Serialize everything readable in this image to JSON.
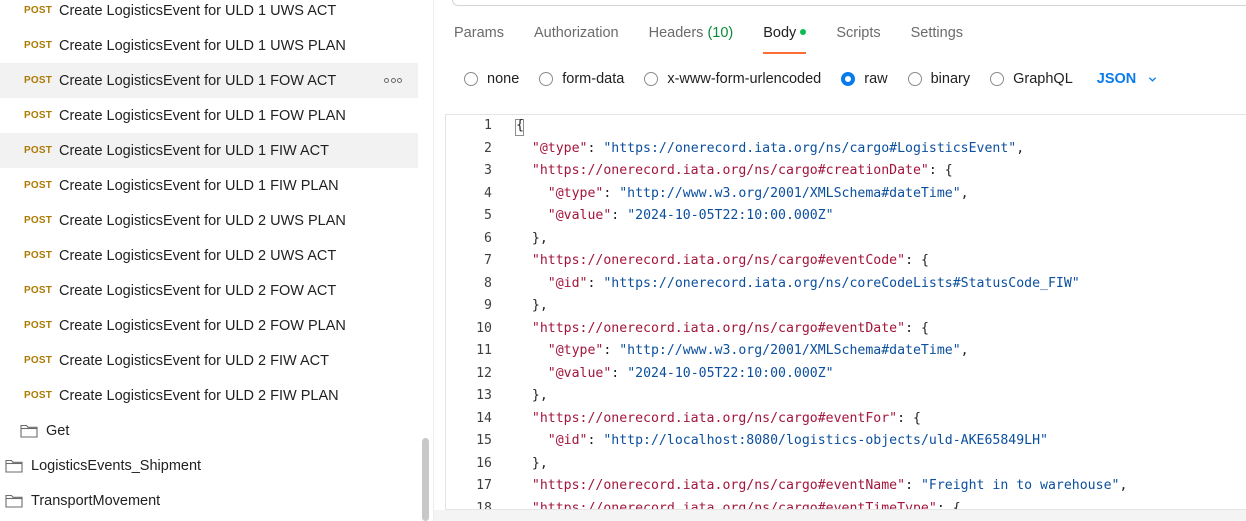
{
  "sidebar": {
    "items": [
      {
        "method": "POST",
        "name": "Create LogisticsEvent for ULD 1 UWS ACT"
      },
      {
        "method": "POST",
        "name": "Create LogisticsEvent for ULD 1 UWS PLAN"
      },
      {
        "method": "POST",
        "name": "Create LogisticsEvent for ULD 1 FOW ACT"
      },
      {
        "method": "POST",
        "name": "Create LogisticsEvent for ULD 1 FOW PLAN"
      },
      {
        "method": "POST",
        "name": "Create LogisticsEvent for ULD 1 FIW ACT"
      },
      {
        "method": "POST",
        "name": "Create LogisticsEvent for ULD 1 FIW PLAN"
      },
      {
        "method": "POST",
        "name": "Create LogisticsEvent for ULD 2 UWS PLAN"
      },
      {
        "method": "POST",
        "name": "Create LogisticsEvent for ULD 2 UWS ACT"
      },
      {
        "method": "POST",
        "name": "Create LogisticsEvent for ULD 2 FOW ACT"
      },
      {
        "method": "POST",
        "name": "Create LogisticsEvent for ULD 2 FOW PLAN"
      },
      {
        "method": "POST",
        "name": "Create LogisticsEvent for ULD 2 FIW ACT"
      },
      {
        "method": "POST",
        "name": "Create LogisticsEvent for ULD 2 FIW PLAN"
      }
    ],
    "folders": [
      {
        "name": "Get"
      },
      {
        "name": "LogisticsEvents_Shipment"
      },
      {
        "name": "TransportMovement"
      }
    ]
  },
  "tabs": {
    "params": "Params",
    "authorization": "Authorization",
    "headers": "Headers",
    "headers_count": "(10)",
    "body": "Body",
    "scripts": "Scripts",
    "settings": "Settings"
  },
  "body_types": {
    "none": "none",
    "form_data": "form-data",
    "urlencoded": "x-www-form-urlencoded",
    "raw": "raw",
    "binary": "binary",
    "graphql": "GraphQL",
    "selected": "raw",
    "language": "JSON"
  },
  "editor": {
    "lines": [
      {
        "n": "1",
        "parts": [
          [
            "p",
            "{"
          ]
        ]
      },
      {
        "n": "2",
        "parts": [
          [
            "p",
            "  "
          ],
          [
            "k",
            "\"@type\""
          ],
          [
            "p",
            ": "
          ],
          [
            "s",
            "\"https://onerecord.iata.org/ns/cargo#LogisticsEvent\""
          ],
          [
            "p",
            ","
          ]
        ]
      },
      {
        "n": "3",
        "parts": [
          [
            "p",
            "  "
          ],
          [
            "k",
            "\"https://onerecord.iata.org/ns/cargo#creationDate\""
          ],
          [
            "p",
            ": {"
          ]
        ]
      },
      {
        "n": "4",
        "parts": [
          [
            "p",
            "    "
          ],
          [
            "k",
            "\"@type\""
          ],
          [
            "p",
            ": "
          ],
          [
            "s",
            "\"http://www.w3.org/2001/XMLSchema#dateTime\""
          ],
          [
            "p",
            ","
          ]
        ]
      },
      {
        "n": "5",
        "parts": [
          [
            "p",
            "    "
          ],
          [
            "k",
            "\"@value\""
          ],
          [
            "p",
            ": "
          ],
          [
            "s",
            "\"2024-10-05T22:10:00.000Z\""
          ]
        ]
      },
      {
        "n": "6",
        "parts": [
          [
            "p",
            "  },"
          ]
        ]
      },
      {
        "n": "7",
        "parts": [
          [
            "p",
            "  "
          ],
          [
            "k",
            "\"https://onerecord.iata.org/ns/cargo#eventCode\""
          ],
          [
            "p",
            ": {"
          ]
        ]
      },
      {
        "n": "8",
        "parts": [
          [
            "p",
            "    "
          ],
          [
            "k",
            "\"@id\""
          ],
          [
            "p",
            ": "
          ],
          [
            "s",
            "\"https://onerecord.iata.org/ns/coreCodeLists#StatusCode_FIW\""
          ]
        ]
      },
      {
        "n": "9",
        "parts": [
          [
            "p",
            "  },"
          ]
        ]
      },
      {
        "n": "10",
        "parts": [
          [
            "p",
            "  "
          ],
          [
            "k",
            "\"https://onerecord.iata.org/ns/cargo#eventDate\""
          ],
          [
            "p",
            ": {"
          ]
        ]
      },
      {
        "n": "11",
        "parts": [
          [
            "p",
            "    "
          ],
          [
            "k",
            "\"@type\""
          ],
          [
            "p",
            ": "
          ],
          [
            "s",
            "\"http://www.w3.org/2001/XMLSchema#dateTime\""
          ],
          [
            "p",
            ","
          ]
        ]
      },
      {
        "n": "12",
        "parts": [
          [
            "p",
            "    "
          ],
          [
            "k",
            "\"@value\""
          ],
          [
            "p",
            ": "
          ],
          [
            "s",
            "\"2024-10-05T22:10:00.000Z\""
          ]
        ]
      },
      {
        "n": "13",
        "parts": [
          [
            "p",
            "  },"
          ]
        ]
      },
      {
        "n": "14",
        "parts": [
          [
            "p",
            "  "
          ],
          [
            "k",
            "\"https://onerecord.iata.org/ns/cargo#eventFor\""
          ],
          [
            "p",
            ": {"
          ]
        ]
      },
      {
        "n": "15",
        "parts": [
          [
            "p",
            "    "
          ],
          [
            "k",
            "\"@id\""
          ],
          [
            "p",
            ": "
          ],
          [
            "s",
            "\"http://localhost:8080/logistics-objects/uld-AKE65849LH\""
          ]
        ]
      },
      {
        "n": "16",
        "parts": [
          [
            "p",
            "  },"
          ]
        ]
      },
      {
        "n": "17",
        "parts": [
          [
            "p",
            "  "
          ],
          [
            "k",
            "\"https://onerecord.iata.org/ns/cargo#eventName\""
          ],
          [
            "p",
            ": "
          ],
          [
            "s",
            "\"Freight in to warehouse\""
          ],
          [
            "p",
            ","
          ]
        ]
      },
      {
        "n": "18",
        "parts": [
          [
            "p",
            "  "
          ],
          [
            "k",
            "\"https://onerecord.iata.org/ns/cargo#eventTimeType\""
          ],
          [
            "p",
            ": {"
          ]
        ]
      }
    ]
  }
}
